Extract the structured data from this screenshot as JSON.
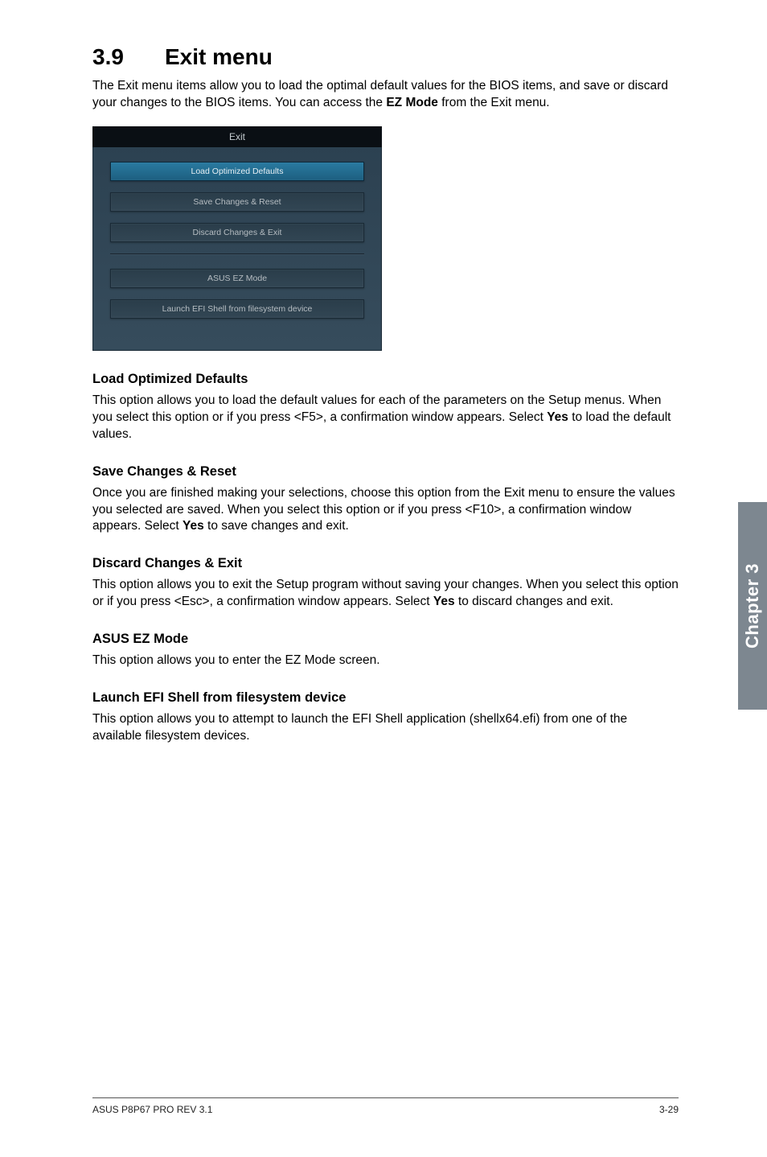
{
  "section": {
    "number": "3.9",
    "title": "Exit menu"
  },
  "intro": {
    "part1": "The Exit menu items allow you to load the optimal default values for the BIOS items, and save or discard your changes to the BIOS items. You can access the ",
    "bold": "EZ Mode",
    "part2": " from the Exit menu."
  },
  "bios": {
    "title": "Exit",
    "buttons": {
      "load_defaults": "Load Optimized Defaults",
      "save_reset": "Save Changes & Reset",
      "discard_exit": "Discard Changes & Exit",
      "ez_mode": "ASUS EZ Mode",
      "launch_efi": "Launch EFI Shell from filesystem device"
    }
  },
  "subsections": {
    "load_defaults": {
      "heading": "Load Optimized Defaults",
      "p1": "This option allows you to load the default values for each of the parameters on the Setup menus. When you select this option or if you press <F5>, a confirmation window appears. Select ",
      "bold": "Yes",
      "p2": " to load the default values."
    },
    "save_reset": {
      "heading": "Save Changes & Reset",
      "p1": "Once you are finished making your selections, choose this option from the Exit menu to ensure the values you selected are saved. When you select this option or if you press <F10>, a confirmation window appears. Select ",
      "bold": "Yes",
      "p2": " to save changes and exit."
    },
    "discard_exit": {
      "heading": "Discard Changes & Exit",
      "p1": "This option allows you to exit the Setup program without saving your changes. When you select this option or if you press <Esc>, a confirmation window appears. Select ",
      "bold": "Yes",
      "p2": " to discard changes and exit."
    },
    "ez_mode": {
      "heading": "ASUS EZ Mode",
      "text": "This option allows you to enter the EZ Mode screen."
    },
    "launch_efi": {
      "heading": "Launch EFI Shell from filesystem device",
      "text": "This option allows you to attempt to launch the EFI Shell application (shellx64.efi) from one of the available filesystem devices."
    }
  },
  "side_tab": "Chapter 3",
  "footer": {
    "left": "ASUS P8P67 PRO REV 3.1",
    "right": "3-29"
  }
}
